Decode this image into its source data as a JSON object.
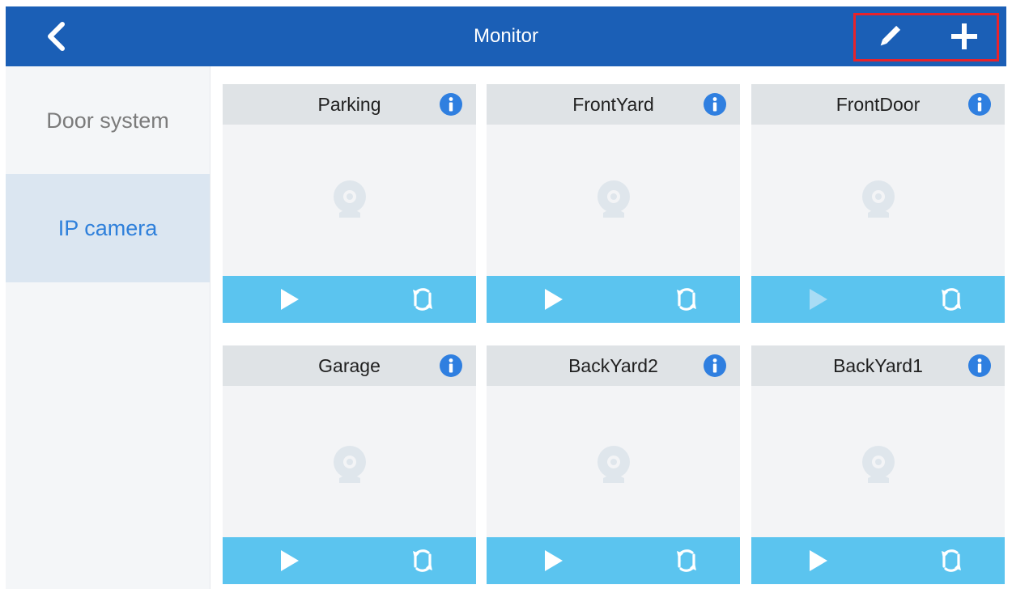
{
  "header": {
    "title": "Monitor",
    "back_icon": "chevron-left-icon",
    "edit_icon": "pencil-icon",
    "add_icon": "plus-icon",
    "highlight_color": "#e8232b",
    "background_color": "#1b5fb6"
  },
  "sidebar": {
    "items": [
      {
        "label": "Door system",
        "selected": false
      },
      {
        "label": "IP camera",
        "selected": true
      }
    ]
  },
  "cameras": [
    {
      "name": "Parking",
      "play_enabled": true
    },
    {
      "name": "FrontYard",
      "play_enabled": true
    },
    {
      "name": "FrontDoor",
      "play_enabled": false
    },
    {
      "name": "Garage",
      "play_enabled": true
    },
    {
      "name": "BackYard2",
      "play_enabled": true
    },
    {
      "name": "BackYard1",
      "play_enabled": true
    }
  ],
  "colors": {
    "controls_bar": "#5bc4ef",
    "info_icon": "#2f7fe0",
    "selected_sidebar_text": "#2f80db"
  }
}
